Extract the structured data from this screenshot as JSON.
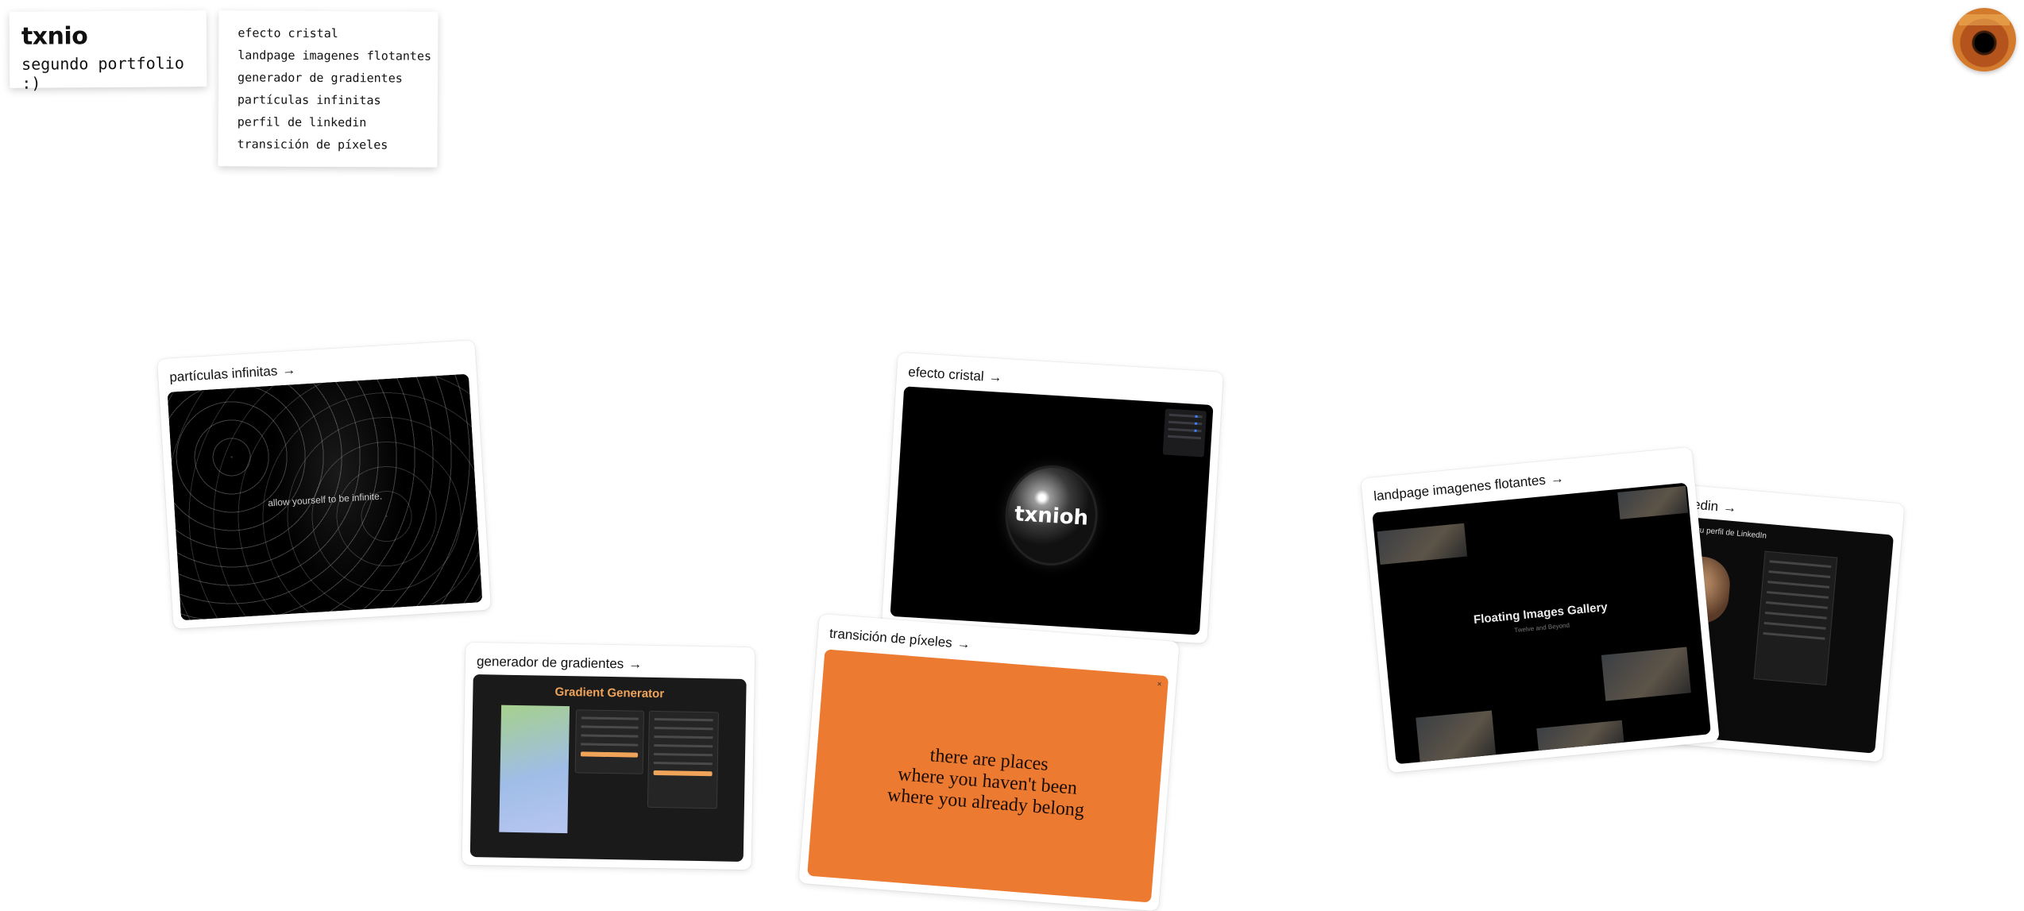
{
  "brand": {
    "title": "txnio",
    "subtitle": "segundo portfolio :)"
  },
  "menu": {
    "items": [
      "efecto cristal",
      "landpage imagenes flotantes",
      "generador de gradientes",
      "partículas infinitas",
      "perfil de linkedin",
      "transición de píxeles"
    ]
  },
  "avatar": {
    "icon": "album-cover-avatar"
  },
  "arrow_glyph": "→",
  "cards": {
    "particulas": {
      "label": "partículas infinitas",
      "screenshot_text": "allow yourself to be infinite."
    },
    "cristal": {
      "label": "efecto cristal",
      "screenshot_text": "txnioh"
    },
    "gradientes": {
      "label": "generador de gradientes",
      "screenshot_title": "Gradient Generator"
    },
    "pixeles": {
      "label": "transición de píxeles",
      "screenshot_lines": [
        "there are places",
        "where you haven't been",
        "where you already belong"
      ],
      "close_glyph": "×"
    },
    "flotantes": {
      "label": "landpage imagenes flotantes",
      "screenshot_title": "Floating Images Gallery",
      "screenshot_sub": "Twelve and Beyond"
    },
    "linkedin": {
      "label": "perfil de linkedin",
      "screenshot_title": "Mejora tu perfil de LinkedIn"
    }
  },
  "colors": {
    "page_bg": "#ffffff",
    "pixel_orange": "#ec7a31",
    "gradient_accent": "#f0a45a"
  }
}
